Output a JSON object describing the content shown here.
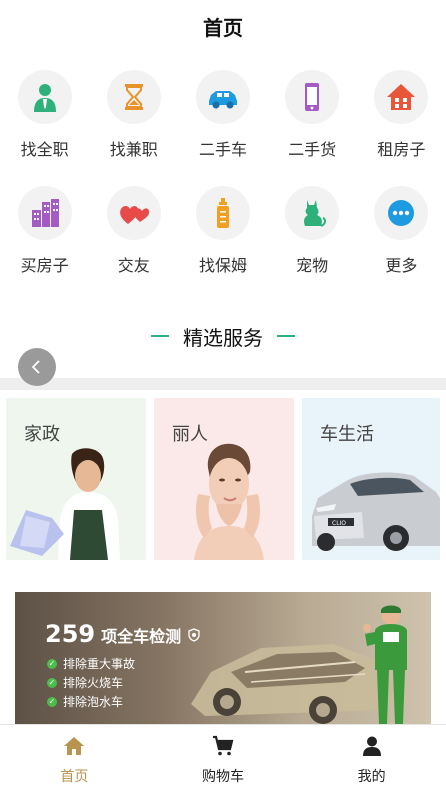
{
  "header": {
    "title": "首页"
  },
  "grid": {
    "row1": [
      {
        "label": "找全职",
        "icon": "person-tie-icon",
        "color": "#2db07a"
      },
      {
        "label": "找兼职",
        "icon": "hourglass-icon",
        "color": "#e8922a"
      },
      {
        "label": "二手车",
        "icon": "car-icon",
        "color": "#1e9be0"
      },
      {
        "label": "二手货",
        "icon": "phone-icon",
        "color": "#a45bc6"
      },
      {
        "label": "租房子",
        "icon": "house-icon",
        "color": "#e8563a"
      }
    ],
    "row2": [
      {
        "label": "买房子",
        "icon": "buildings-icon",
        "color": "#a45bc6"
      },
      {
        "label": "交友",
        "icon": "hearts-icon",
        "color": "#e84a4a"
      },
      {
        "label": "找保姆",
        "icon": "baby-bottle-icon",
        "color": "#f0a020"
      },
      {
        "label": "宠物",
        "icon": "cat-icon",
        "color": "#2db07a"
      },
      {
        "label": "更多",
        "icon": "more-dots-icon",
        "color": "#1e9be0"
      }
    ]
  },
  "section": {
    "title": "精选服务",
    "line_color": "#2db07a"
  },
  "cards": [
    {
      "label": "家政",
      "icon": "housekeeping-photo"
    },
    {
      "label": "丽人",
      "icon": "beauty-photo"
    },
    {
      "label": "车生活",
      "icon": "car-photo"
    }
  ],
  "banner": {
    "number": "259",
    "title": "项全车检测",
    "items": [
      "排除重大事故",
      "排除火烧车",
      "排除泡水车"
    ]
  },
  "tabbar": {
    "items": [
      {
        "label": "首页",
        "icon": "home-icon",
        "active": true
      },
      {
        "label": "购物车",
        "icon": "cart-icon",
        "active": false
      },
      {
        "label": "我的",
        "icon": "user-icon",
        "active": false
      }
    ],
    "active_color": "#b8944e"
  }
}
